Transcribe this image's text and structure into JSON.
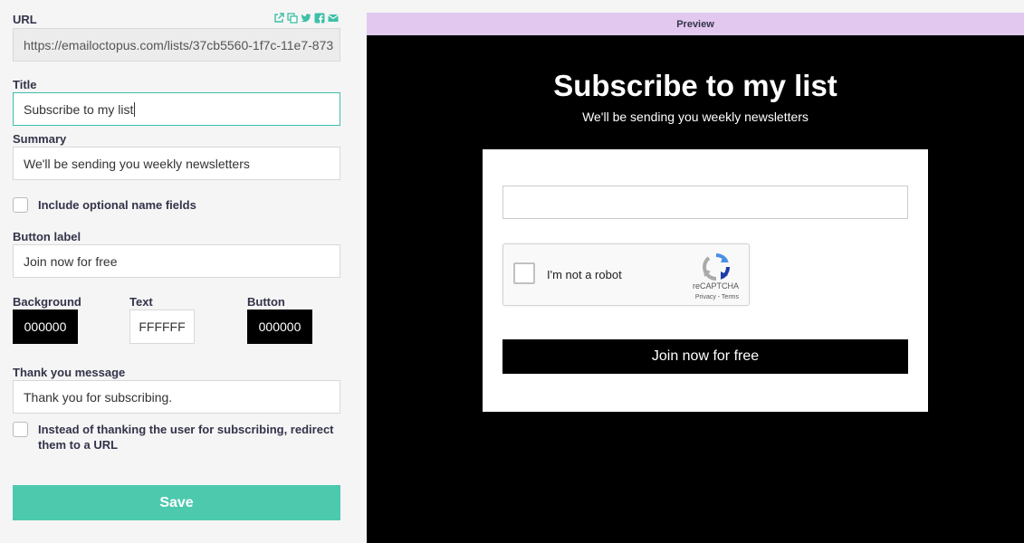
{
  "form": {
    "url": {
      "label": "URL",
      "value": "https://emailoctopus.com/lists/37cb5560-1f7c-11e7-873"
    },
    "share_icons": [
      "external-link-icon",
      "copy-icon",
      "twitter-icon",
      "facebook-icon",
      "email-icon"
    ],
    "title": {
      "label": "Title",
      "value": "Subscribe to my list"
    },
    "summary": {
      "label": "Summary",
      "value": "We'll be sending you weekly newsletters"
    },
    "name_fields": {
      "label": "Include optional name fields",
      "checked": false
    },
    "button_label": {
      "label": "Button label",
      "value": "Join now for free"
    },
    "colors": {
      "background": {
        "label": "Background",
        "value": "000000"
      },
      "text": {
        "label": "Text",
        "value": "FFFFFF"
      },
      "button": {
        "label": "Button",
        "value": "000000"
      }
    },
    "thank_you": {
      "label": "Thank you message",
      "value": "Thank you for subscribing."
    },
    "redirect": {
      "label": "Instead of thanking the user for subscribing, redirect them to a URL",
      "checked": false
    },
    "save_label": "Save"
  },
  "preview": {
    "bar_label": "Preview",
    "title": "Subscribe to my list",
    "summary": "We'll be sending you weekly newsletters",
    "captcha": {
      "label": "I'm not a robot",
      "brand": "reCAPTCHA",
      "links": "Privacy - Terms"
    },
    "button_label": "Join now for free"
  },
  "theme": {
    "accent": "#4dc9ae",
    "preview_bar": "#e2c8ee"
  }
}
